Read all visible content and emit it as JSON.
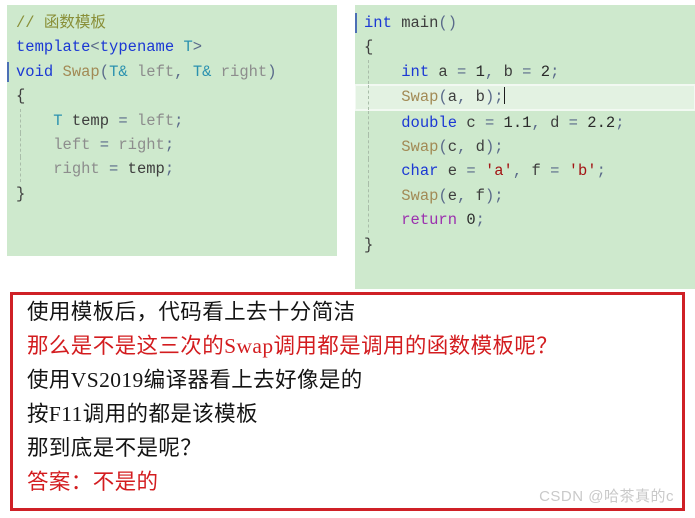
{
  "code_left": {
    "language": "C++",
    "background_color": "#cee9cd",
    "lines": [
      {
        "id": "l1",
        "indent": 0,
        "guide": false,
        "change_marker": false,
        "tokens": [
          {
            "text": "// 函数模板",
            "kind": "comment"
          }
        ]
      },
      {
        "id": "l2",
        "indent": 0,
        "guide": false,
        "change_marker": false,
        "tokens": [
          {
            "text": "template",
            "kind": "key"
          },
          {
            "text": "<",
            "kind": "punct"
          },
          {
            "text": "typename",
            "kind": "key"
          },
          {
            "text": " ",
            "kind": "id"
          },
          {
            "text": "T",
            "kind": "type"
          },
          {
            "text": ">",
            "kind": "punct"
          }
        ]
      },
      {
        "id": "l3",
        "indent": 0,
        "guide": false,
        "change_marker": true,
        "tokens": [
          {
            "text": "void",
            "kind": "key"
          },
          {
            "text": " ",
            "kind": "id"
          },
          {
            "text": "Swap",
            "kind": "func"
          },
          {
            "text": "(",
            "kind": "punct"
          },
          {
            "text": "T&",
            "kind": "type"
          },
          {
            "text": " left",
            "kind": "idlite"
          },
          {
            "text": ",",
            "kind": "punct"
          },
          {
            "text": " ",
            "kind": "id"
          },
          {
            "text": "T&",
            "kind": "type"
          },
          {
            "text": " right",
            "kind": "idlite"
          },
          {
            "text": ")",
            "kind": "punct"
          }
        ]
      },
      {
        "id": "l4",
        "indent": 0,
        "guide": false,
        "change_marker": false,
        "tokens": [
          {
            "text": "{",
            "kind": "id"
          }
        ]
      },
      {
        "id": "l5",
        "indent": 1,
        "guide": true,
        "change_marker": false,
        "tokens": [
          {
            "text": "    ",
            "kind": "id"
          },
          {
            "text": "T",
            "kind": "type"
          },
          {
            "text": " temp",
            "kind": "id"
          },
          {
            "text": " = ",
            "kind": "punct"
          },
          {
            "text": "left",
            "kind": "idlite"
          },
          {
            "text": ";",
            "kind": "punct"
          }
        ]
      },
      {
        "id": "l6",
        "indent": 1,
        "guide": true,
        "change_marker": false,
        "tokens": [
          {
            "text": "    ",
            "kind": "id"
          },
          {
            "text": "left",
            "kind": "idlite"
          },
          {
            "text": " = ",
            "kind": "punct"
          },
          {
            "text": "right",
            "kind": "idlite"
          },
          {
            "text": ";",
            "kind": "punct"
          }
        ]
      },
      {
        "id": "l7",
        "indent": 1,
        "guide": true,
        "change_marker": false,
        "tokens": [
          {
            "text": "    ",
            "kind": "id"
          },
          {
            "text": "right",
            "kind": "idlite"
          },
          {
            "text": " = ",
            "kind": "punct"
          },
          {
            "text": "temp",
            "kind": "id"
          },
          {
            "text": ";",
            "kind": "punct"
          }
        ]
      },
      {
        "id": "l8",
        "indent": 0,
        "guide": false,
        "change_marker": false,
        "tokens": [
          {
            "text": "}",
            "kind": "id"
          }
        ]
      }
    ]
  },
  "code_right": {
    "language": "C++",
    "background_color": "#cee9cd",
    "current_line_id": "r3",
    "lines": [
      {
        "id": "r1",
        "indent": 0,
        "guide": false,
        "change_marker": true,
        "current": false,
        "tokens": [
          {
            "text": "int",
            "kind": "key"
          },
          {
            "text": " main",
            "kind": "id"
          },
          {
            "text": "()",
            "kind": "punct"
          }
        ]
      },
      {
        "id": "r2",
        "indent": 0,
        "guide": false,
        "change_marker": false,
        "current": false,
        "tokens": [
          {
            "text": "{",
            "kind": "id"
          }
        ]
      },
      {
        "id": "r3",
        "indent": 1,
        "guide": true,
        "change_marker": false,
        "current": false,
        "tokens": [
          {
            "text": "    ",
            "kind": "id"
          },
          {
            "text": "int",
            "kind": "key"
          },
          {
            "text": " a",
            "kind": "id"
          },
          {
            "text": " = ",
            "kind": "punct"
          },
          {
            "text": "1",
            "kind": "num"
          },
          {
            "text": ",",
            "kind": "punct"
          },
          {
            "text": " b",
            "kind": "id"
          },
          {
            "text": " = ",
            "kind": "punct"
          },
          {
            "text": "2",
            "kind": "num"
          },
          {
            "text": ";",
            "kind": "punct"
          }
        ]
      },
      {
        "id": "r4",
        "indent": 1,
        "guide": true,
        "change_marker": false,
        "current": true,
        "tokens": [
          {
            "text": "    ",
            "kind": "id"
          },
          {
            "text": "Swap",
            "kind": "func"
          },
          {
            "text": "(",
            "kind": "punct"
          },
          {
            "text": "a",
            "kind": "id"
          },
          {
            "text": ",",
            "kind": "punct"
          },
          {
            "text": " b",
            "kind": "id"
          },
          {
            "text": ")",
            "kind": "punct"
          },
          {
            "text": ";",
            "kind": "punct"
          }
        ]
      },
      {
        "id": "r5",
        "indent": 1,
        "guide": true,
        "change_marker": false,
        "current": false,
        "tokens": [
          {
            "text": "    ",
            "kind": "id"
          },
          {
            "text": "double",
            "kind": "key"
          },
          {
            "text": " c",
            "kind": "id"
          },
          {
            "text": " = ",
            "kind": "punct"
          },
          {
            "text": "1.1",
            "kind": "num"
          },
          {
            "text": ",",
            "kind": "punct"
          },
          {
            "text": " d",
            "kind": "id"
          },
          {
            "text": " = ",
            "kind": "punct"
          },
          {
            "text": "2.2",
            "kind": "num"
          },
          {
            "text": ";",
            "kind": "punct"
          }
        ]
      },
      {
        "id": "r6",
        "indent": 1,
        "guide": true,
        "change_marker": false,
        "current": false,
        "tokens": [
          {
            "text": "    ",
            "kind": "id"
          },
          {
            "text": "Swap",
            "kind": "func"
          },
          {
            "text": "(",
            "kind": "punct"
          },
          {
            "text": "c",
            "kind": "id"
          },
          {
            "text": ",",
            "kind": "punct"
          },
          {
            "text": " d",
            "kind": "id"
          },
          {
            "text": ")",
            "kind": "punct"
          },
          {
            "text": ";",
            "kind": "punct"
          }
        ]
      },
      {
        "id": "r7",
        "indent": 1,
        "guide": true,
        "change_marker": false,
        "current": false,
        "tokens": [
          {
            "text": "    ",
            "kind": "id"
          },
          {
            "text": "char",
            "kind": "key"
          },
          {
            "text": " e",
            "kind": "id"
          },
          {
            "text": " = ",
            "kind": "punct"
          },
          {
            "text": "'a'",
            "kind": "char"
          },
          {
            "text": ",",
            "kind": "punct"
          },
          {
            "text": " f",
            "kind": "id"
          },
          {
            "text": " = ",
            "kind": "punct"
          },
          {
            "text": "'b'",
            "kind": "char"
          },
          {
            "text": ";",
            "kind": "punct"
          }
        ]
      },
      {
        "id": "r8",
        "indent": 1,
        "guide": true,
        "change_marker": false,
        "current": false,
        "tokens": [
          {
            "text": "    ",
            "kind": "id"
          },
          {
            "text": "Swap",
            "kind": "func"
          },
          {
            "text": "(",
            "kind": "punct"
          },
          {
            "text": "e",
            "kind": "id"
          },
          {
            "text": ",",
            "kind": "punct"
          },
          {
            "text": " f",
            "kind": "id"
          },
          {
            "text": ")",
            "kind": "punct"
          },
          {
            "text": ";",
            "kind": "punct"
          }
        ]
      },
      {
        "id": "r9",
        "indent": 1,
        "guide": true,
        "change_marker": false,
        "current": false,
        "tokens": [
          {
            "text": "    ",
            "kind": "id"
          },
          {
            "text": "return",
            "kind": "ret"
          },
          {
            "text": " 0",
            "kind": "num"
          },
          {
            "text": ";",
            "kind": "punct"
          }
        ]
      },
      {
        "id": "r10",
        "indent": 0,
        "guide": false,
        "change_marker": false,
        "current": false,
        "tokens": [
          {
            "text": "}",
            "kind": "id"
          }
        ]
      }
    ]
  },
  "note_box": {
    "border_color": "#cf2026",
    "background_color": "#ffffff",
    "lines": [
      {
        "text": "使用模板后，代码看上去十分简洁",
        "color": "black"
      },
      {
        "text": "那么是不是这三次的Swap调用都是调用的函数模板呢？",
        "color": "red"
      },
      {
        "text": "使用VS2019编译器看上去好像是的",
        "color": "black"
      },
      {
        "text": "按F11调用的都是该模板",
        "color": "black"
      },
      {
        "text": "那到底是不是呢？",
        "color": "black"
      },
      {
        "text": "答案：不是的",
        "color": "red"
      }
    ]
  },
  "watermark": {
    "text": "CSDN @哈茶真的c",
    "color": "#c9c9c9"
  }
}
